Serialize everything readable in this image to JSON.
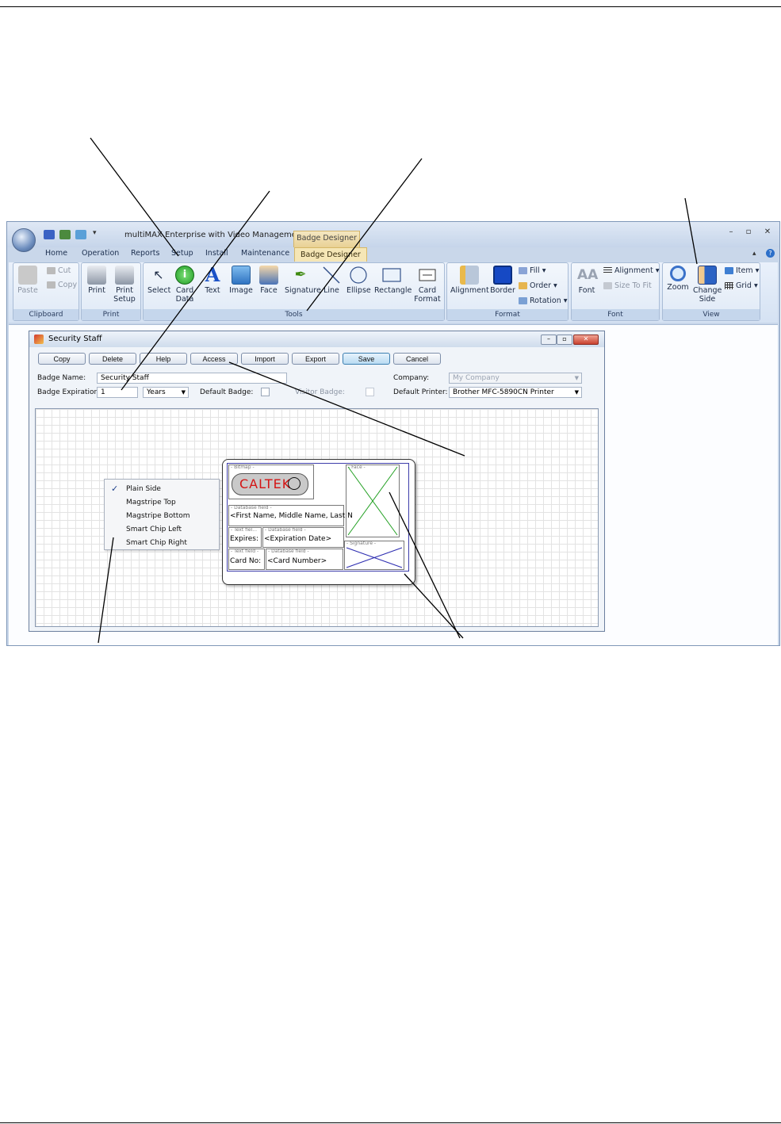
{
  "app": {
    "title": "multiMAX Enterprise with Video Management",
    "context_tab_header": "Badge Designer",
    "tabs": [
      "Home",
      "Operation",
      "Reports",
      "Setup",
      "Install",
      "Maintenance",
      "Badge Designer"
    ]
  },
  "ribbon": {
    "clipboard": {
      "label": "Clipboard",
      "paste": "Paste",
      "cut": "Cut",
      "copy": "Copy"
    },
    "print": {
      "label": "Print",
      "print": "Print",
      "print_setup": "Print Setup"
    },
    "tools": {
      "label": "Tools",
      "select": "Select",
      "card_data": "Card Data",
      "text": "Text",
      "image": "Image",
      "face": "Face",
      "signature": "Signature",
      "line": "Line",
      "ellipse": "Ellipse",
      "rectangle": "Rectangle",
      "card_format": "Card Format"
    },
    "format": {
      "label": "Format",
      "alignment": "Alignment",
      "border": "Border",
      "fill": "Fill",
      "order": "Order",
      "rotation": "Rotation"
    },
    "font": {
      "label": "Font",
      "font": "Font",
      "alignment": "Alignment",
      "size_to_fit": "Size To Fit"
    },
    "view": {
      "label": "View",
      "zoom": "Zoom",
      "change_side": "Change Side",
      "item": "Item",
      "grid": "Grid"
    }
  },
  "dialog": {
    "title": "Security Staff",
    "buttons": [
      "Copy",
      "Delete",
      "Help",
      "Access",
      "Import",
      "Export",
      "Save",
      "Cancel"
    ],
    "badge_name_label": "Badge Name:",
    "badge_name_value": "Security Staff",
    "badge_expiration_label": "Badge Expiration:",
    "badge_expiration_value": "1",
    "expiration_unit": "Years",
    "default_badge_label": "Default Badge:",
    "visitor_badge_label": "Visitor Badge:",
    "company_label": "Company:",
    "company_value": "My Company",
    "default_printer_label": "Default Printer:",
    "default_printer_value": "Brother MFC-5890CN Printer"
  },
  "side_menu": {
    "items": [
      "Plain Side",
      "Magstripe Top",
      "Magstripe Bottom",
      "Smart Chip Left",
      "Smart Chip Right"
    ],
    "checked": "Plain Side"
  },
  "badge": {
    "bitmap_tag": "- Bitmap -",
    "logo_text": "CALTEK",
    "face_tag": "- Face -",
    "db_tag": "- Database field -",
    "name_field": "<First Name, Middle Name, Last N",
    "text_tag": "- Text fiel...",
    "expires_text": "Expires:",
    "expiration_field": "<Expiration Date>",
    "text_tag2": "- Text field -",
    "card_no_text": "Card No:",
    "card_number_field": "<Card Number>",
    "signature_tag": "- Signature -"
  }
}
